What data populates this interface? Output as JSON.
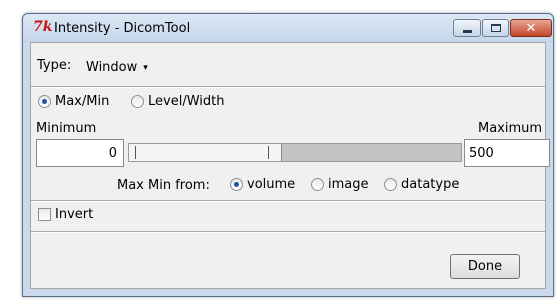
{
  "window": {
    "title": "Intensity - DicomTool",
    "app_icon_glyph": "7k",
    "app_icon_color": "#cc1111"
  },
  "type_row": {
    "label": "Type:",
    "value": "Window",
    "arrow_glyph": "▾"
  },
  "mode": {
    "options": [
      {
        "label": "Max/Min",
        "checked": true
      },
      {
        "label": "Level/Width",
        "checked": false
      }
    ]
  },
  "range": {
    "min_label": "Minimum",
    "max_label": "Maximum",
    "min_value": "0",
    "max_value": "500"
  },
  "source": {
    "label": "Max Min from:",
    "options": [
      {
        "label": "volume",
        "checked": true
      },
      {
        "label": "image",
        "checked": false
      },
      {
        "label": "datatype",
        "checked": false
      }
    ]
  },
  "invert": {
    "label": "Invert",
    "checked": false
  },
  "done_label": "Done",
  "colors": {
    "accent": "#1d5599",
    "titlebar": "#c4d6ea",
    "close_button": "#c4462a"
  }
}
